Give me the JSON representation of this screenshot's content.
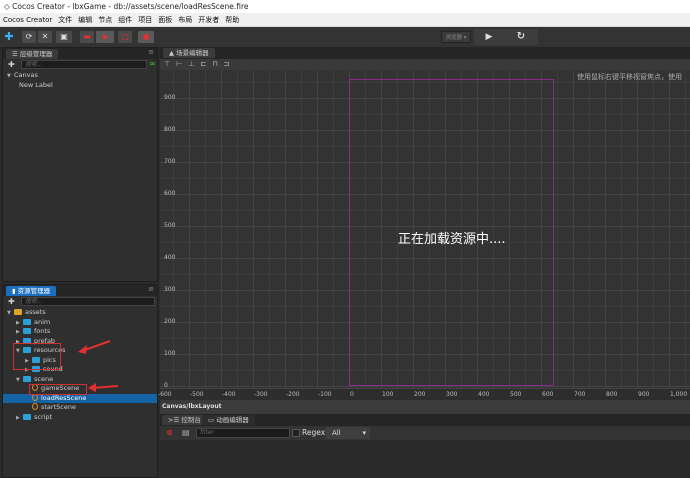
{
  "window": {
    "title": "Cocos Creator - lbxGame - db://assets/scene/loadResScene.fire"
  },
  "menu": [
    "Cocos Creator",
    "文件",
    "编辑",
    "节点",
    "组件",
    "项目",
    "面板",
    "布局",
    "开发者",
    "帮助"
  ],
  "toolbar": {
    "platform": "浏览器",
    "play": "▶",
    "refresh": "↻"
  },
  "hierarchy": {
    "title": "层级管理器",
    "search_placeholder": "搜索...",
    "nodes": [
      {
        "label": "Canvas"
      },
      {
        "label": "New Label"
      }
    ]
  },
  "assets": {
    "title": "资源管理器",
    "search_placeholder": "搜索...",
    "items": [
      {
        "label": "assets",
        "depth": 0,
        "type": "root",
        "open": true
      },
      {
        "label": "anim",
        "depth": 1,
        "type": "folder"
      },
      {
        "label": "fonts",
        "depth": 1,
        "type": "folder"
      },
      {
        "label": "prefab",
        "depth": 1,
        "type": "folder"
      },
      {
        "label": "resources",
        "depth": 1,
        "type": "folder",
        "open": true
      },
      {
        "label": "pics",
        "depth": 2,
        "type": "folder"
      },
      {
        "label": "sound",
        "depth": 2,
        "type": "folder"
      },
      {
        "label": "scene",
        "depth": 1,
        "type": "folder",
        "open": true
      },
      {
        "label": "gameScene",
        "depth": 2,
        "type": "scene"
      },
      {
        "label": "loadResScene",
        "depth": 2,
        "type": "scene",
        "selected": true
      },
      {
        "label": "startScene",
        "depth": 2,
        "type": "scene"
      },
      {
        "label": "script",
        "depth": 1,
        "type": "folder"
      }
    ]
  },
  "scene": {
    "title": "场景编辑器",
    "hint": "使用鼠标右键平移视窗焦点，使用",
    "loading_text": "正在加载资源中....",
    "y_ticks": [
      "900",
      "800",
      "700",
      "600",
      "500",
      "400",
      "300",
      "200",
      "100",
      "0"
    ],
    "x_ticks": [
      "-600",
      "-500",
      "-400",
      "-300",
      "-200",
      "-100",
      "0",
      "100",
      "200",
      "300",
      "400",
      "500",
      "600",
      "700",
      "800",
      "900",
      "1,000"
    ],
    "path": "Canvas/lbxLayout",
    "design_resolution": [
      640,
      960
    ],
    "canvas_color": "#8a2a8a"
  },
  "console": {
    "tabs": [
      "控制台",
      "动画编辑器"
    ],
    "filter_placeholder": "filter",
    "regex_label": "Regex",
    "level": "All"
  },
  "colors": {
    "selection": "#1463a5",
    "annotation": "#e03030"
  }
}
